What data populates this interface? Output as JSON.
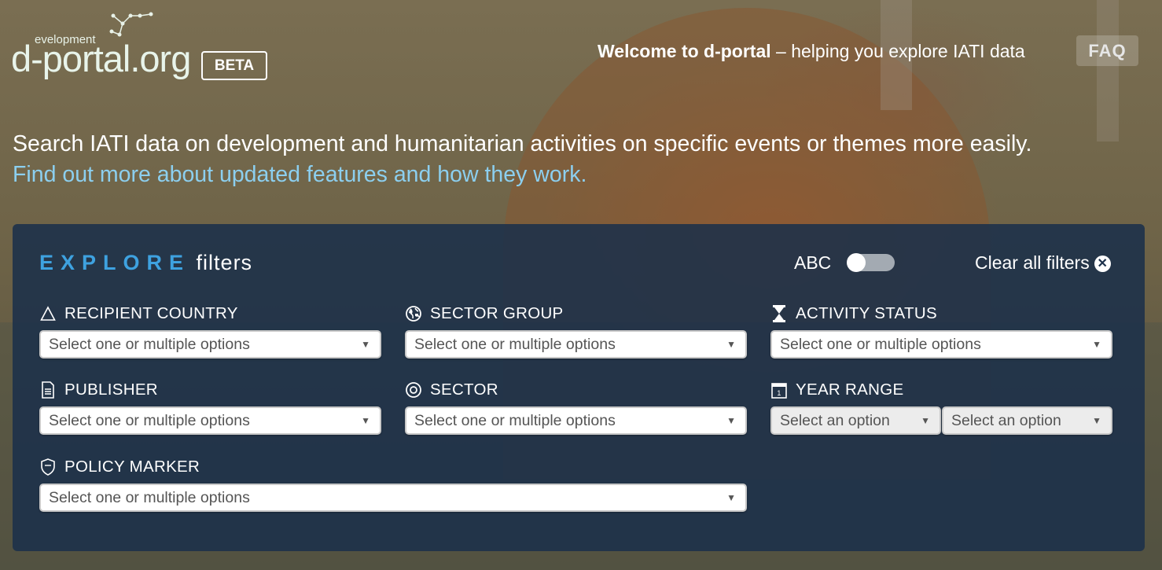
{
  "header": {
    "logo_dev": "evelopment",
    "logo_main": "d-portal.org",
    "beta": "BETA",
    "welcome_bold": "Welcome to d-portal",
    "welcome_rest": " – helping you explore IATI data",
    "faq": "FAQ"
  },
  "intro": {
    "line1": "Search IATI data on development and humanitarian activities on specific events or themes more easily.",
    "link": "Find out more about updated features and how they work."
  },
  "explore": {
    "title_big": "EXPLORE",
    "title_small": "filters",
    "abc_label": "ABC",
    "abc_toggle_on": false,
    "clear_all": "Clear all filters",
    "filters": [
      {
        "label": "RECIPIENT COUNTRY",
        "icon": "triangle-icon",
        "placeholder": "Select one or multiple options"
      },
      {
        "label": "SECTOR GROUP",
        "icon": "globe-icon",
        "placeholder": "Select one or multiple options"
      },
      {
        "label": "ACTIVITY STATUS",
        "icon": "hourglass-icon",
        "placeholder": "Select one or multiple options"
      },
      {
        "label": "PUBLISHER",
        "icon": "document-icon",
        "placeholder": "Select one or multiple options"
      },
      {
        "label": "SECTOR",
        "icon": "target-icon",
        "placeholder": "Select one or multiple options"
      },
      {
        "label": "YEAR RANGE",
        "icon": "calendar-icon",
        "from_placeholder": "Select an option",
        "to_placeholder": "Select an option"
      },
      {
        "label": "POLICY MARKER",
        "icon": "shield-icon",
        "placeholder": "Select one or multiple options"
      }
    ]
  },
  "colors": {
    "accent_blue": "#3ea2e0",
    "link_blue": "#8ccfef",
    "panel_bg": "#1b304a"
  }
}
